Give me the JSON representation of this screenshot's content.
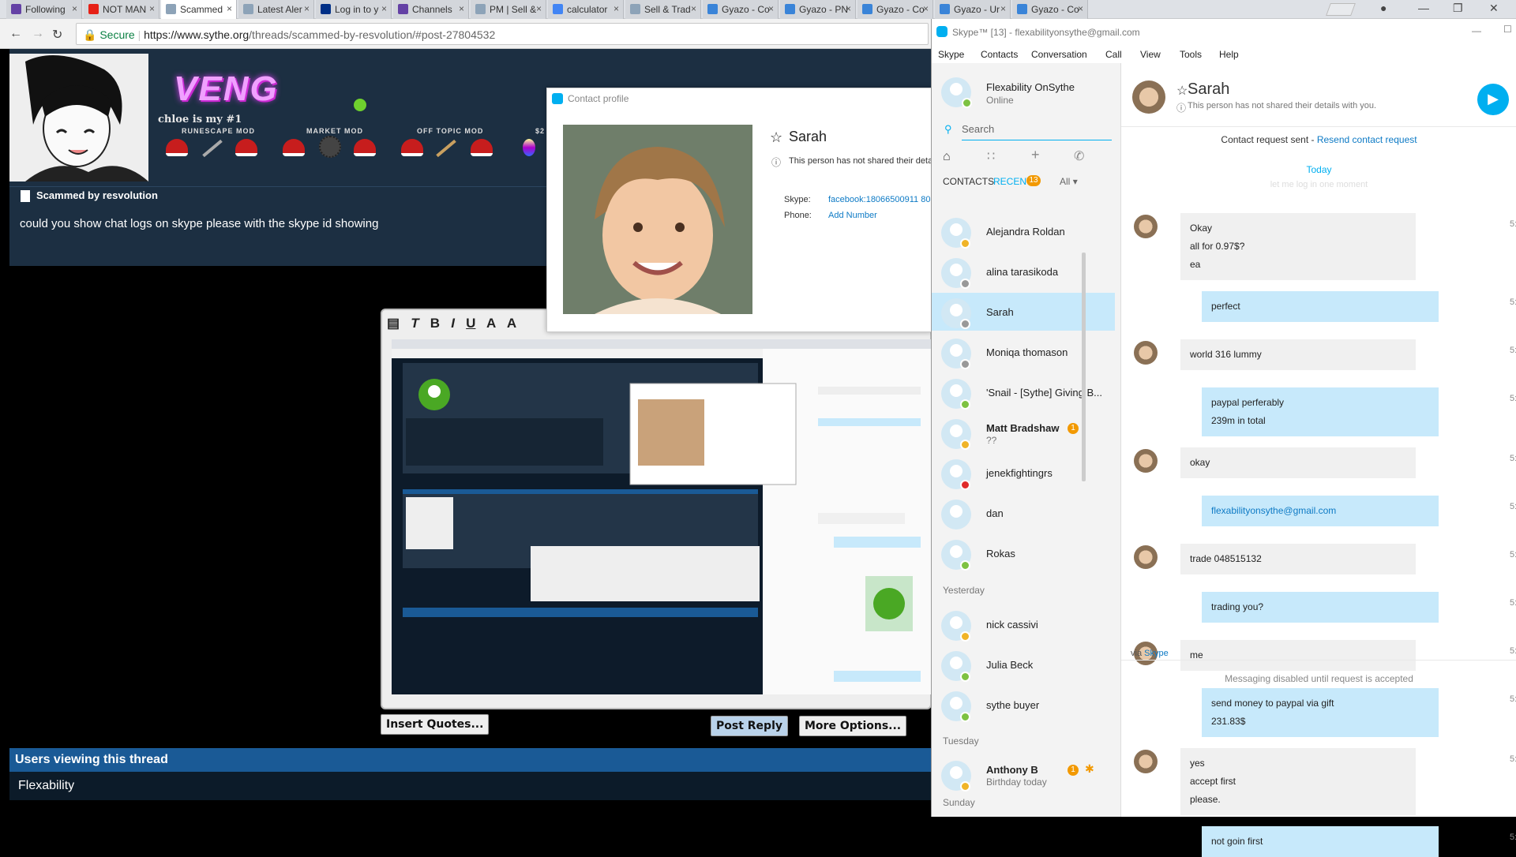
{
  "browser": {
    "tabs": [
      {
        "label": "Following",
        "icon": "twitch-icon",
        "color": "#6441a5"
      },
      {
        "label": "NOT MAN",
        "icon": "youtube-icon",
        "color": "#e62117"
      },
      {
        "label": "Scammed",
        "icon": "shield-icon",
        "color": "#8da3b8"
      },
      {
        "label": "Latest Aler",
        "icon": "shield-icon",
        "color": "#8da3b8"
      },
      {
        "label": "Log in to y",
        "icon": "paypal-icon",
        "color": "#003087"
      },
      {
        "label": "Channels",
        "icon": "twitch-icon",
        "color": "#6441a5"
      },
      {
        "label": "PM | Sell &",
        "icon": "shield-icon",
        "color": "#8da3b8"
      },
      {
        "label": "calculator",
        "icon": "google-icon",
        "color": "#4285f4"
      },
      {
        "label": "Sell & Trad",
        "icon": "shield-icon",
        "color": "#8da3b8"
      },
      {
        "label": "Gyazo - Co",
        "icon": "gyazo-icon",
        "color": "#3a84d8"
      },
      {
        "label": "Gyazo - PN",
        "icon": "gyazo-icon",
        "color": "#3a84d8"
      },
      {
        "label": "Gyazo - Co",
        "icon": "gyazo-icon",
        "color": "#3a84d8"
      },
      {
        "label": "Gyazo - Ur",
        "icon": "gyazo-icon",
        "color": "#3a84d8"
      },
      {
        "label": "Gyazo - Co",
        "icon": "gyazo-icon",
        "color": "#3a84d8"
      }
    ],
    "secure_label": "Secure",
    "url_prefix": "https://www.sythe.org",
    "url_path": "/threads/scammed-by-resvolution/#post-27804532"
  },
  "forum": {
    "sig_title": "VENG",
    "sig_caption": "chloe is my #1",
    "ranks": [
      "RUNESCAPE MOD",
      "MARKET MOD",
      "OFF TOPIC MOD",
      "$2"
    ],
    "post_title": "Scammed by resvolution",
    "post_body": "could you show chat logs on skype please with the skype id showing",
    "insert_quotes": "Insert Quotes...",
    "post_reply": "Post Reply",
    "more_options": "More Options...",
    "users_viewing_title": "Users viewing this thread",
    "users_viewing": "Flexability"
  },
  "contact_profile": {
    "header": "Contact profile",
    "name": "Sarah",
    "note": "This person has not shared their detai",
    "skype_label": "Skype:",
    "skype_value": "facebook:18066500911 80",
    "phone_label": "Phone:",
    "phone_value": "Add Number"
  },
  "skype": {
    "title": "Skype™ [13] - flexabilityonsythe@gmail.com",
    "menu": [
      "Skype",
      "Contacts",
      "Conversation",
      "Call",
      "View",
      "Tools",
      "Help"
    ],
    "me_name": "Flexability OnSythe",
    "me_status": "Online",
    "search_placeholder": "Search",
    "tab_contacts": "CONTACTS",
    "tab_recent": "RECENT",
    "recent_count": "13",
    "filter": "All",
    "contacts": [
      {
        "name": "Alejandra Roldan",
        "sub": "",
        "status": "#f0b428",
        "badge": ""
      },
      {
        "name": "alina tarasikoda",
        "sub": "",
        "status": "#999999",
        "badge": ""
      },
      {
        "name": "Sarah",
        "sub": "",
        "status": "#999999",
        "badge": ""
      },
      {
        "name": "Moniqa thomason",
        "sub": "",
        "status": "#999999",
        "badge": ""
      },
      {
        "name": "'Snail - [Sythe] Giving B...",
        "sub": "",
        "status": "#7dc242",
        "badge": ""
      },
      {
        "name": "Matt Bradshaw",
        "sub": "??",
        "status": "#f0b428",
        "badge": "1"
      },
      {
        "name": "jenekfightingrs",
        "sub": "",
        "status": "#e02b2b",
        "badge": ""
      },
      {
        "name": "dan",
        "sub": "",
        "status": "",
        "badge": ""
      },
      {
        "name": "Rokas",
        "sub": "",
        "status": "#7dc242",
        "badge": ""
      }
    ],
    "section_yesterday": "Yesterday",
    "yesterday": [
      {
        "name": "nick cassivi",
        "status": "#f0b428"
      },
      {
        "name": "Julia Beck",
        "status": "#7dc242"
      },
      {
        "name": "sythe buyer",
        "status": "#7dc242"
      }
    ],
    "section_tuesday": "Tuesday",
    "tuesday": {
      "name": "Anthony B",
      "sub": "Birthday today",
      "badge": "1",
      "status": "#f0b428"
    },
    "section_sunday": "Sunday",
    "chat": {
      "name": "Sarah",
      "note": "This person has not shared their details with you.",
      "request_sent": "Contact request sent - ",
      "resend": "Resend contact request",
      "today": "Today",
      "faded": "let me log in one moment",
      "messages": [
        {
          "side": "L",
          "lines": [
            "Okay",
            "all for 0.97$?",
            "ea"
          ]
        },
        {
          "side": "R",
          "lines": [
            "perfect"
          ]
        },
        {
          "side": "L",
          "lines": [
            "world 316 lummy"
          ]
        },
        {
          "side": "R",
          "lines": [
            "paypal perferably",
            "239m in total"
          ]
        },
        {
          "side": "L",
          "lines": [
            "okay"
          ]
        },
        {
          "side": "R",
          "lines": [
            "flexabilityonsythe@gmail.com"
          ],
          "link": true
        },
        {
          "side": "L",
          "lines": [
            "trade 048515132"
          ]
        },
        {
          "side": "R",
          "lines": [
            "trading you?"
          ]
        },
        {
          "side": "L",
          "lines": [
            "me"
          ]
        },
        {
          "side": "R",
          "lines": [
            "send money to paypal via gift",
            "231.83$"
          ]
        },
        {
          "side": "L",
          "lines": [
            "yes",
            "accept first",
            "please."
          ]
        },
        {
          "side": "R",
          "lines": [
            "not goin first"
          ]
        }
      ],
      "via_prefix": "via ",
      "via_link": "Skype",
      "disabled": "Messaging disabled until request is accepted",
      "time_stub": "5:"
    },
    "accent": "#00aff0"
  }
}
